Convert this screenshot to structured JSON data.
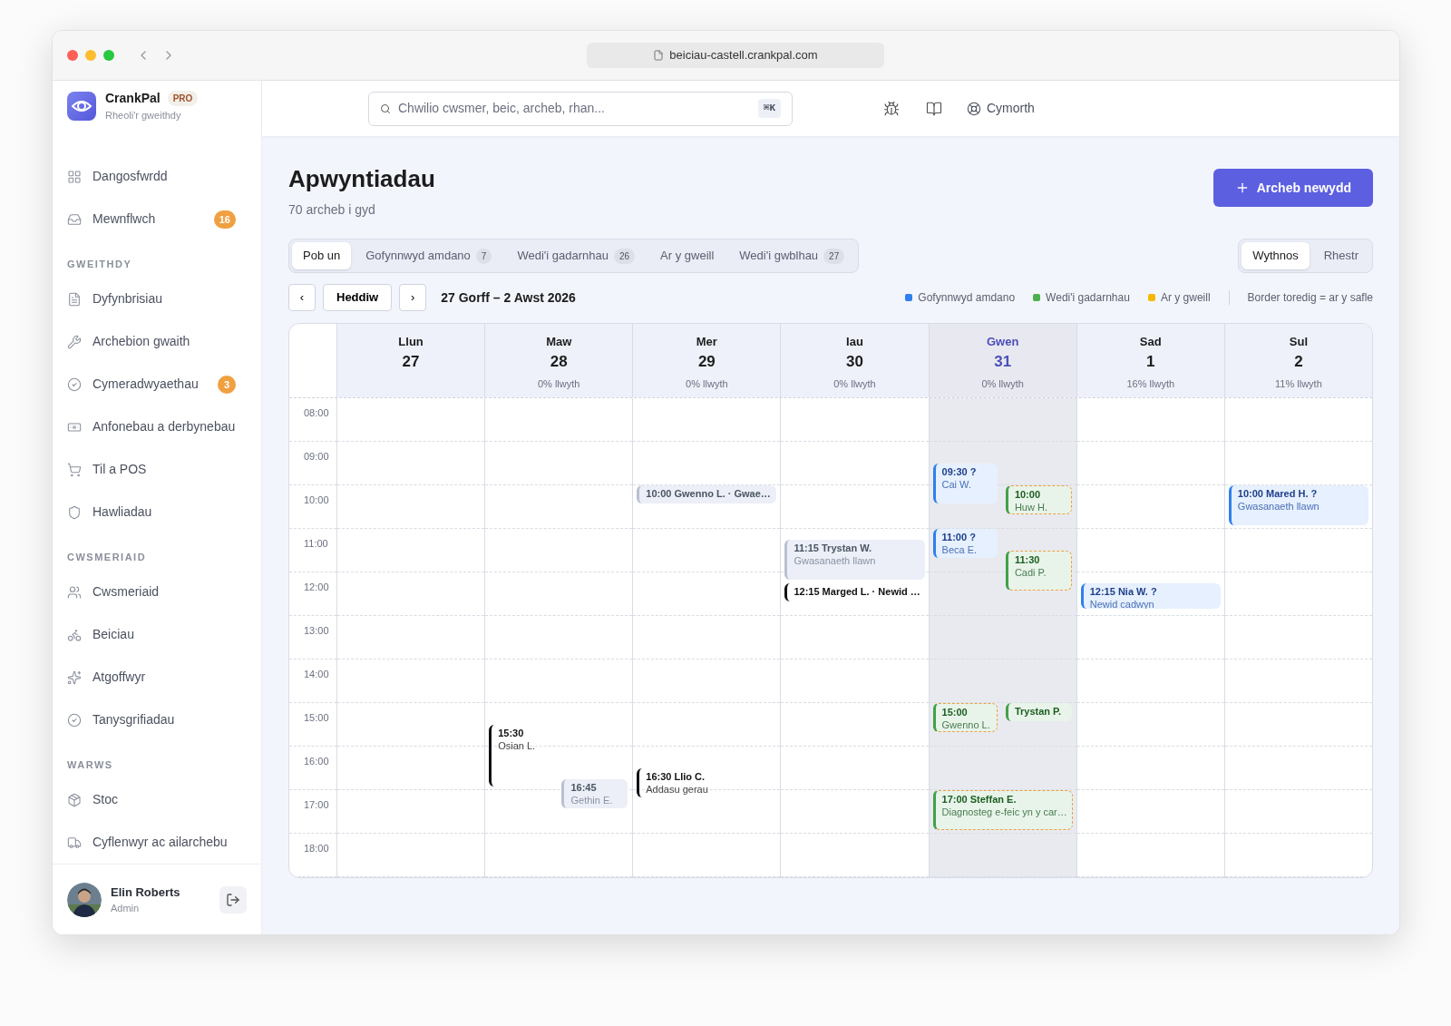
{
  "browser": {
    "url": "beiciau-castell.crankpal.com"
  },
  "brand": {
    "name": "CrankPal",
    "badge": "PRO",
    "subtitle": "Rheoli'r gweithdy"
  },
  "header": {
    "search": {
      "placeholder": "Chwilio cwsmer, beic, archeb, rhan...",
      "shortcut": "⌘K"
    },
    "help": "Cymorth"
  },
  "sidebar": {
    "sections": [
      {
        "items": [
          {
            "label": "Dangosfwrdd"
          },
          {
            "label": "Mewnflwch",
            "badge": "16"
          }
        ]
      },
      {
        "label": "GWEITHDY",
        "items": [
          {
            "label": "Dyfynbrisiau"
          },
          {
            "label": "Archebion gwaith"
          },
          {
            "label": "Cymeradwyaethau",
            "badge": "3"
          },
          {
            "label": "Anfonebau a derbynebau"
          },
          {
            "label": "Til a POS"
          },
          {
            "label": "Hawliadau"
          }
        ]
      },
      {
        "label": "CWSMERIAID",
        "items": [
          {
            "label": "Cwsmeriaid"
          },
          {
            "label": "Beiciau"
          },
          {
            "label": "Atgoffwyr"
          },
          {
            "label": "Tanysgrifiadau"
          }
        ]
      },
      {
        "label": "WARWS",
        "items": [
          {
            "label": "Stoc"
          },
          {
            "label": "Cyflenwyr ac ailarchebu"
          }
        ]
      }
    ],
    "user": {
      "name": "Elin Roberts",
      "role": "Admin"
    }
  },
  "page": {
    "title": "Apwyntiadau",
    "subtitle": "70 archeb i gyd",
    "new_button": "Archeb newydd"
  },
  "filters": [
    {
      "label": "Pob un",
      "selected": true
    },
    {
      "label": "Gofynnwyd amdano",
      "count": "7",
      "selected": false
    },
    {
      "label": "Wedi'i gadarnhau",
      "count": "26",
      "selected": false
    },
    {
      "label": "Ar y gweill",
      "selected": false
    },
    {
      "label": "Wedi'i gwblhau",
      "count": "27",
      "selected": false
    }
  ],
  "views": [
    {
      "label": "Wythnos",
      "selected": true
    },
    {
      "label": "Rhestr",
      "selected": false
    }
  ],
  "navigation": {
    "prev": "‹",
    "today": "Heddiw",
    "next": "›",
    "range": "27 Gorff – 2 Awst 2026"
  },
  "legend": [
    {
      "label": "Gofynnwyd amdano",
      "color": "#2f80ed"
    },
    {
      "label": "Wedi'i gadarnhau",
      "color": "#4caf50"
    },
    {
      "label": "Ar y gweill",
      "color": "#f5b800"
    }
  ],
  "legend_note": "Border toredig = ar y safle",
  "calendar": {
    "hours": [
      "08:00",
      "09:00",
      "10:00",
      "11:00",
      "12:00",
      "13:00",
      "14:00",
      "15:00",
      "16:00",
      "17:00",
      "18:00"
    ],
    "days": [
      {
        "name": "Llun",
        "date": "27",
        "selected": false
      },
      {
        "name": "Maw",
        "date": "28",
        "load": "0% llwyth",
        "selected": false,
        "events": [
          {
            "heading": "15:30",
            "detail": "Osian L.",
            "kind": "plain",
            "on_site": false
          },
          {
            "heading": "16:45",
            "detail": "Gethin E.",
            "kind": "muted",
            "on_site": false
          }
        ]
      },
      {
        "name": "Mer",
        "date": "29",
        "load": "0% llwyth",
        "selected": false,
        "events": [
          {
            "heading": "10:00 Gwenno L. · Gwae…",
            "kind": "muted",
            "on_site": false
          },
          {
            "heading": "16:30 Llio C.",
            "detail": "Addasu gerau",
            "kind": "plain",
            "on_site": false
          }
        ]
      },
      {
        "name": "Iau",
        "date": "30",
        "load": "0% llwyth",
        "selected": false,
        "events": [
          {
            "heading": "11:15 Trystan W.",
            "detail": "Gwasanaeth llawn",
            "kind": "muted",
            "on_site": false
          },
          {
            "heading": "12:15 Marged L. · Newid …",
            "kind": "plain",
            "on_site": false
          }
        ]
      },
      {
        "name": "Gwen",
        "date": "31",
        "load": "0% llwyth",
        "selected": true,
        "events": [
          {
            "heading": "09:30 ?",
            "detail": "Cai W.",
            "kind": "requested",
            "on_site": false
          },
          {
            "heading": "10:00",
            "detail": "Huw H.",
            "kind": "confirmed",
            "on_site": true
          },
          {
            "heading": "11:00 ?",
            "detail": "Beca E.",
            "kind": "requested",
            "on_site": false
          },
          {
            "heading": "11:30",
            "detail": "Cadi P.",
            "kind": "confirmed",
            "on_site": true
          },
          {
            "heading": "15:00",
            "detail": "Gwenno L.",
            "kind": "confirmed",
            "on_site": true
          },
          {
            "heading": "Trystan P.",
            "kind": "confirmed",
            "on_site": false
          },
          {
            "heading": "17:00 Steffan E.",
            "detail": "Diagnosteg e-feic yn y car…",
            "kind": "confirmed",
            "on_site": true
          }
        ]
      },
      {
        "name": "Sad",
        "date": "1",
        "load": "16% llwyth",
        "selected": false,
        "events": [
          {
            "heading": "12:15 Nia W. ?",
            "detail": "Newid cadwyn",
            "kind": "requested",
            "on_site": false
          }
        ]
      },
      {
        "name": "Sul",
        "date": "2",
        "load": "11% llwyth",
        "selected": false,
        "events": [
          {
            "heading": "10:00 Mared H. ?",
            "detail": "Gwasanaeth llawn",
            "kind": "requested",
            "on_site": false
          }
        ]
      }
    ]
  }
}
